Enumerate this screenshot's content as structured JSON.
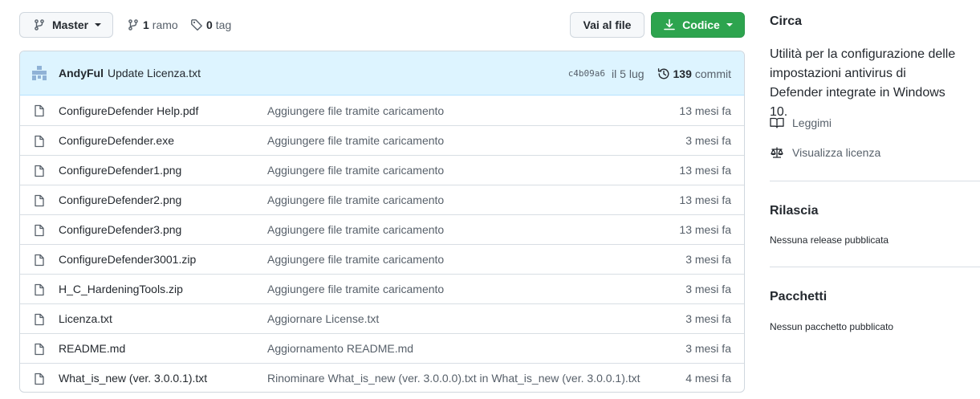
{
  "toolbar": {
    "branch_label": "Master",
    "branches_count": "1",
    "branches_label": "ramo",
    "tags_count": "0",
    "tags_label": "tag",
    "go_to_file_label": "Vai al file",
    "code_label": "Codice"
  },
  "commit": {
    "author": "AndyFul",
    "message": "Update Licenza.txt",
    "sha": "c4b09a6",
    "date": "il 5 lug",
    "commits_count": "139",
    "commits_label": "commit"
  },
  "files": [
    {
      "name": "ConfigureDefender Help.pdf",
      "message": "Aggiungere file tramite caricamento",
      "age": "13 mesi fa"
    },
    {
      "name": "ConfigureDefender.exe",
      "message": "Aggiungere file tramite caricamento",
      "age": "3 mesi fa"
    },
    {
      "name": "ConfigureDefender1.png",
      "message": "Aggiungere file tramite caricamento",
      "age": "13 mesi fa"
    },
    {
      "name": "ConfigureDefender2.png",
      "message": "Aggiungere file tramite caricamento",
      "age": "13 mesi fa"
    },
    {
      "name": "ConfigureDefender3.png",
      "message": "Aggiungere file tramite caricamento",
      "age": "13 mesi fa"
    },
    {
      "name": "ConfigureDefender3001.zip",
      "message": "Aggiungere file tramite caricamento",
      "age": "3 mesi fa"
    },
    {
      "name": "H_C_HardeningTools.zip",
      "message": "Aggiungere file tramite caricamento",
      "age": "3 mesi fa"
    },
    {
      "name": "Licenza.txt",
      "message": "Aggiornare License.txt",
      "age": "3 mesi fa"
    },
    {
      "name": "README.md",
      "message": "Aggiornamento README.md",
      "age": "3 mesi fa"
    },
    {
      "name": "What_is_new (ver. 3.0.0.1).txt",
      "message": "Rinominare What_is_new (ver. 3.0.0.0).txt in What_is_new (ver. 3.0.0.1).txt",
      "age": "4 mesi fa"
    }
  ],
  "sidebar": {
    "about_title": "Circa",
    "about_description": "Utilità per la configurazione delle impostazioni antivirus di Defender integrate in Windows 10.",
    "readme_label": "Leggimi",
    "license_label": "Visualizza licenza",
    "releases_title": "Rilascia",
    "releases_empty": "Nessuna release pubblicata",
    "packages_title": "Pacchetti",
    "packages_empty": "Nessun pacchetto pubblicato"
  },
  "colors": {
    "accent_green": "#2da44e",
    "commit_header_bg": "#ddf4ff",
    "muted_text": "#57606a",
    "border": "#d0d7de"
  },
  "icons": {
    "branch": "git-branch-icon",
    "tag": "tag-icon",
    "download": "download-icon",
    "avatar": "identicon-avatar",
    "history": "history-icon",
    "file": "file-icon",
    "book": "book-icon",
    "law": "law-icon"
  }
}
